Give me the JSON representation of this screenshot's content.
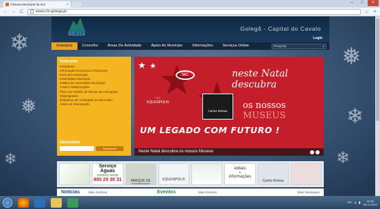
{
  "browser": {
    "tab_title": "Câmara Municipal da Gol",
    "tab_close": "×",
    "url": "www.cm-golega.pt",
    "win_controls": [
      "–",
      "□",
      "×"
    ]
  },
  "site": {
    "logo_text": "GOLEGÃ",
    "title": "Golegã - Capital do Cavalo",
    "login": "Login",
    "nav": [
      "Autarquia",
      "Concelho",
      "Áreas De Actividade",
      "Apoio Ao Munícipe",
      "Informações",
      "Serviços Online"
    ],
    "search_placeholder": "Pesquisa",
    "sidebar": {
      "heading": "Autarquia",
      "items": [
        "Presidente",
        "Informação Económico-Financeira",
        "Executivo Municipal",
        "Assembleia Municipal",
        "Editais da Assembleia Municipal",
        "Actas e Deliberações",
        "Plano de Gestão de Riscos de Corrupção",
        "Organigrama",
        "Relatórios de Actividade do Executivo",
        "Áreas de Intervenção"
      ],
      "newsletter_label": "Newsletter",
      "newsletter_button": "Subscrever"
    },
    "banner": {
      "line1": "neste Natal descubra",
      "line2_prefix": "os nossos ",
      "line2_highlight": "MUSEUS",
      "main": "UM LEGADO COM FUTURO !",
      "caption": "Neste Natal descubra os nossos Museus",
      "mc": "MC",
      "equuspolis": "EQUUSPOLIS",
      "museum": "Carlos Relvas"
    },
    "tiles": {
      "t2_line1": "Serviço Águas",
      "t2_line2": "número verde",
      "t2_number": "800 29 30 31",
      "t3": "PARQUE DE CAMPISMO",
      "t4": "EQUUSPOLIS",
      "t6_line1": "editais",
      "t6_line2": "+",
      "t6_line3": "informações",
      "t7": "Carlos Relvas"
    },
    "footer": {
      "news": "Notícias",
      "more_news": "Mais Notícias",
      "events": "Eventos",
      "more_events": "Mais Eventos",
      "more_highlights": "Mais Destaques"
    }
  },
  "taskbar": {
    "tray": "PT",
    "time": "12:46",
    "date": "20-12-2012"
  }
}
